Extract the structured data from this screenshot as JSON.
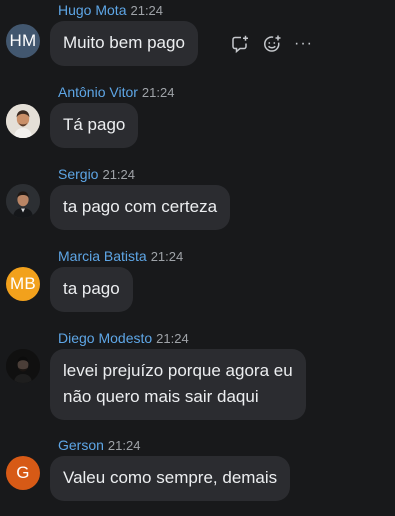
{
  "messages": [
    {
      "name": "Hugo Mota",
      "time": "21:24",
      "text": [
        "Muito bem pago"
      ],
      "avatar": {
        "type": "initials",
        "initials": "HM",
        "color": "#42576f"
      }
    },
    {
      "name": "Antônio Vitor",
      "time": "21:24",
      "text": [
        "Tá pago"
      ],
      "avatar": {
        "type": "photo",
        "icon": "person-photo-light"
      }
    },
    {
      "name": "Sergio",
      "time": "21:24",
      "text": [
        "ta pago com certeza"
      ],
      "avatar": {
        "type": "photo",
        "icon": "person-photo-dark"
      }
    },
    {
      "name": "Marcia Batista",
      "time": "21:24",
      "text": [
        "ta pago"
      ],
      "avatar": {
        "type": "initials",
        "initials": "MB",
        "color": "#f2a11c"
      }
    },
    {
      "name": "Diego Modesto",
      "time": "21:24",
      "text": [
        "levei prejuízo porque agora eu",
        "não quero mais sair daqui"
      ],
      "avatar": {
        "type": "photo",
        "icon": "person-photo-dark"
      }
    },
    {
      "name": "Gerson",
      "time": "21:24",
      "text": [
        "Valeu como sempre, demais"
      ],
      "avatar": {
        "type": "initials",
        "initials": "G",
        "color": "#d75a16"
      }
    }
  ],
  "hover_actions": {
    "icons": [
      "reply-in-thread-icon",
      "add-reaction-icon",
      "more-options-icon"
    ],
    "more_label": "···"
  }
}
